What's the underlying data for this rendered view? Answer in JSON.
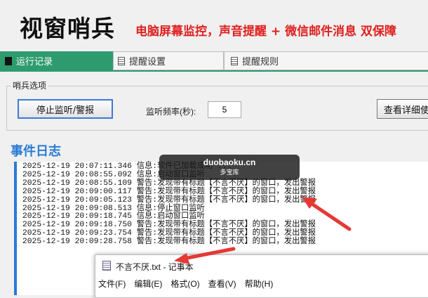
{
  "app": {
    "title": "视窗哨兵",
    "slogan": "电脑屏幕监控，声音提醒 + 微信邮件消息 双保障"
  },
  "tabs": [
    {
      "label": "运行记录",
      "active": true
    },
    {
      "label": "提醒设置",
      "active": false
    },
    {
      "label": "提醒规则",
      "active": false
    }
  ],
  "options": {
    "group_label": "哨兵选项",
    "stop_button": "停止监听/警报",
    "freq_label": "监听频率(秒):",
    "freq_value": "5",
    "help_button": "查看详细使用"
  },
  "log": {
    "title": "事件日志",
    "lines": [
      "2025-12-19 20:07:11.346 信息:软件已加载成功 ...",
      "2025-12-19 20:08:55.092 信息:启动窗口监听",
      "2025-12-19 20:08:55.109 警告:发现带有标题【不言不厌】的窗口，发出警报",
      "2025-12-19 20:09:00.117 警告:发现带有标题【不言不厌】的窗口，发出警报",
      "2025-12-19 20:09:05.123 警告:发现带有标题【不言不厌】的窗口，发出警报",
      "2025-12-19 20:09:08.513 信息:停止窗口监听",
      "2025-12-19 20:09:18.745 信息:启动窗口监听",
      "2025-12-19 20:09:18.750 警告:发现带有标题【不言不厌】的窗口，发出警报",
      "2025-12-19 20:09:23.754 警告:发现带有标题【不言不厌】的窗口，发出警报",
      "2025-12-19 20:09:28.758 警告:发现带有标题【不言不厌】的窗口，发出警报"
    ]
  },
  "watermark": {
    "line1": "duobaoku.cn",
    "line2": "多宝库"
  },
  "notepad": {
    "title": "不言不厌.txt - 记事本",
    "menu": [
      "文件(F)",
      "编辑(E)",
      "格式(O)",
      "查看(V)",
      "帮助(H)"
    ]
  },
  "colors": {
    "accent_green": "#2e9b6f",
    "accent_blue": "#2a7bd4",
    "slogan_red": "#e02020",
    "arrow_red": "#e53935"
  },
  "icons": {
    "tab_icons": [
      "panel-icon",
      "document-icon",
      "document-icon"
    ],
    "notepad_icon": "notepad-icon"
  }
}
